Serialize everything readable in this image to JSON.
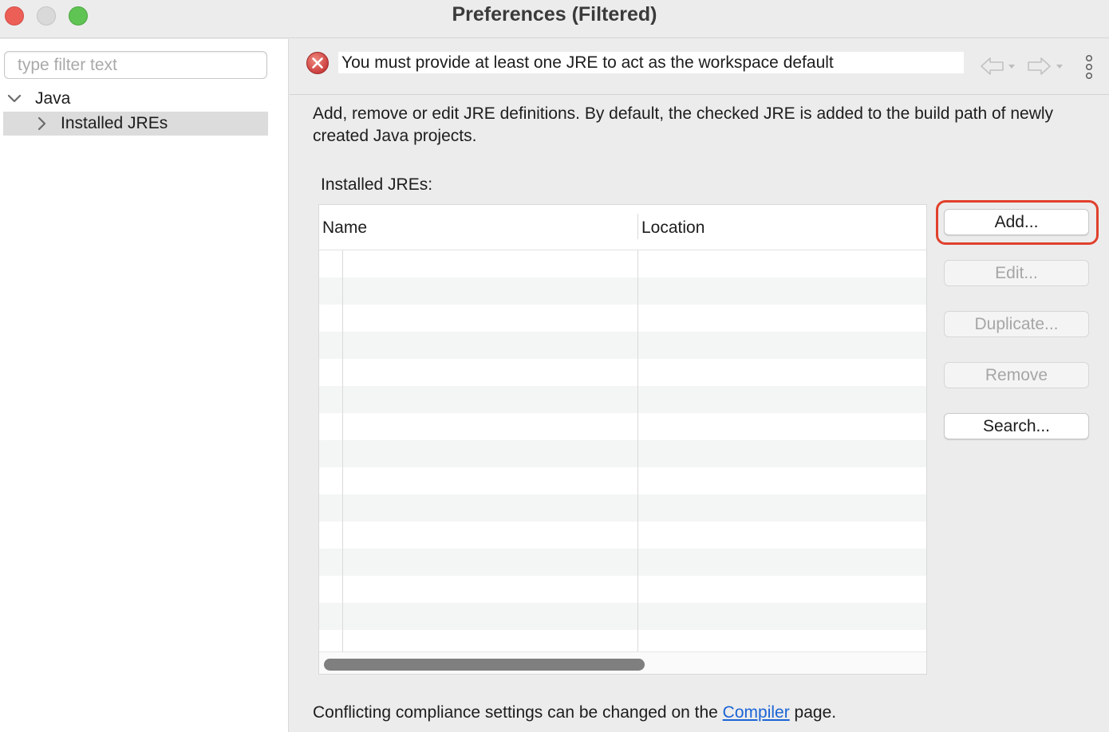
{
  "window": {
    "title": "Preferences (Filtered)"
  },
  "sidebar": {
    "filter_placeholder": "type filter text",
    "tree": [
      {
        "label": "Java",
        "expanded": true
      },
      {
        "label": "Installed JREs",
        "selected": true,
        "expanded": false
      }
    ]
  },
  "message": {
    "text": "You must provide at least one JRE to act as the workspace default",
    "severity": "error",
    "icon": "error-icon"
  },
  "main": {
    "description": "Add, remove or edit JRE definitions. By default, the checked JRE is added to the build path of newly created Java projects.",
    "table_caption": "Installed JREs:",
    "table": {
      "columns": [
        "Name",
        "Location"
      ],
      "rows": []
    },
    "buttons": {
      "add": "Add...",
      "edit": "Edit...",
      "duplicate": "Duplicate...",
      "remove": "Remove",
      "search": "Search..."
    },
    "footer": {
      "prefix": "Conflicting compliance settings can be changed on the ",
      "link": "Compiler",
      "suffix": " page."
    }
  },
  "colors": {
    "accent_highlight": "#e0402c",
    "link": "#1a64d6",
    "error": "#c83a3a"
  }
}
